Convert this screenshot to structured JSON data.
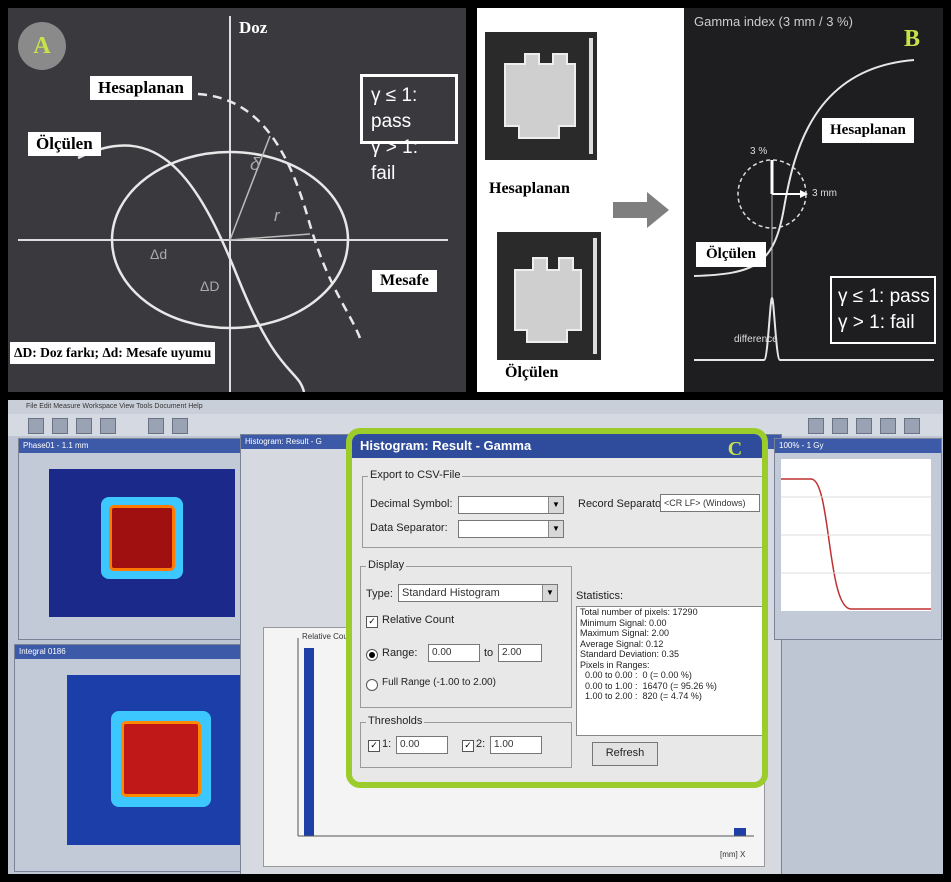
{
  "panel_a": {
    "badge": "A",
    "axis_label_dose": "Doz",
    "label_calculated": "Hesaplanan",
    "label_measured": "Ölçülen",
    "label_distance": "Mesafe",
    "legend_pass": "γ ≤ 1: pass",
    "legend_fail": "γ > 1: fail",
    "sym_delta": "δ",
    "sym_r": "r",
    "sym_dd": "Δd",
    "sym_DD": "ΔD",
    "footnote": "ΔD: Doz farkı; Δd: Mesafe uyumu"
  },
  "panel_b": {
    "badge": "B",
    "title": "Gamma index (3 mm / 3 %)",
    "label_calculated": "Hesaplanan",
    "label_measured": "Ölçülen",
    "img_label_calculated": "Hesaplanan",
    "img_label_measured": "Ölçülen",
    "label_3pct": "3 %",
    "label_3mm": "3 mm",
    "label_difference": "difference",
    "legend_pass": "γ ≤ 1: pass",
    "legend_fail": "γ > 1: fail"
  },
  "panel_c": {
    "badge": "C",
    "menu_text": "File  Edit  Measure  Workspace  View  Tools  Document  Help",
    "win_profile_title": "Phase01 - 1.1 mm",
    "win_integral_title": "Integral 0186",
    "win_profile2_title": "100% - 1 Gy",
    "back_dialog_title": "Histogram: Result - G",
    "dialog": {
      "title": "Histogram: Result - Gamma",
      "export_group": "Export to CSV-File",
      "decimal_symbol_label": "Decimal Symbol:",
      "data_separator_label": "Data Separator:",
      "record_separator_label": "Record Separator:",
      "record_separator_value": "<CR LF> (Windows)",
      "display_group": "Display",
      "type_label": "Type:",
      "type_value": "Standard Histogram",
      "relative_count_label": "Relative Count",
      "range_label": "Range:",
      "range_from": "0.00",
      "range_to_label": "to",
      "range_to": "2.00",
      "full_range_label": "Full Range (-1.00 to 2.00)",
      "thresholds_group": "Thresholds",
      "threshold1_label": "1:",
      "threshold1_value": "0.00",
      "threshold2_label": "2:",
      "threshold2_value": "1.00",
      "statistics_label": "Statistics:",
      "stats": [
        "Total number of pixels: 17290",
        "Minimum Signal: 0.00",
        "Maximum Signal: 2.00",
        "Average Signal: 0.12",
        "Standard Deviation: 0.35",
        "Pixels in Ranges:",
        "  0.00 to 0.00 :  0 (= 0.00 %)",
        "  0.00 to 1.00 :  16470 (= 95.26 %)",
        "  1.00 to 2.00 :  820 (= 4.74 %)"
      ],
      "refresh_label": "Refresh"
    },
    "histogram_ylabel": "Relative Count",
    "histogram_xlabel": "[mm] X"
  }
}
